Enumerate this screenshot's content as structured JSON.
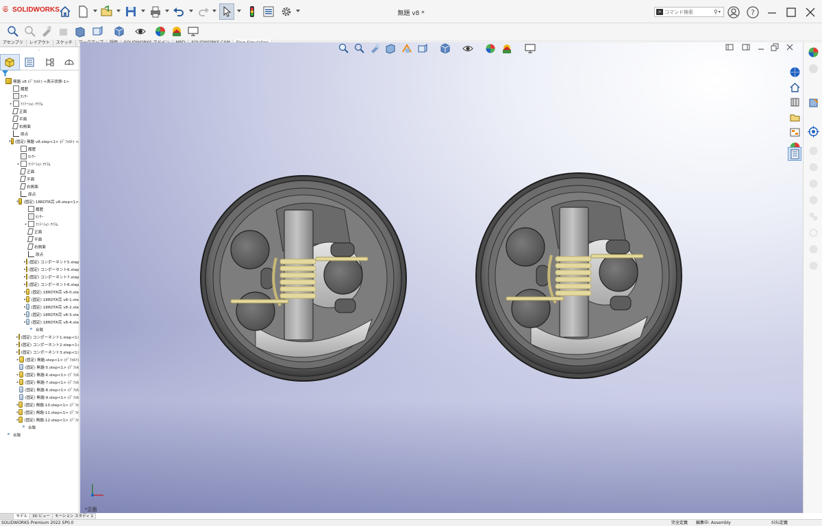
{
  "app": {
    "logo_text": "SOLIDWORKS",
    "document_title": "無題 v8 *",
    "search_placeholder": "コマンド検索"
  },
  "quick_access": [
    {
      "name": "home-icon"
    },
    {
      "name": "new-document-icon"
    },
    {
      "name": "open-icon"
    },
    {
      "name": "save-icon"
    },
    {
      "name": "print-icon"
    },
    {
      "name": "undo-icon"
    },
    {
      "name": "redo-icon"
    },
    {
      "name": "select-icon"
    },
    {
      "name": "rebuild-traffic-light-icon"
    },
    {
      "name": "file-properties-icon"
    },
    {
      "name": "options-gear-icon"
    }
  ],
  "command_tabs": [
    "アセンブリ",
    "レイアウト",
    "スケッチ",
    "マークアップ",
    "評価",
    "SOLIDWORKS アドイン",
    "MBD",
    "SOLIDWORKS CAM",
    "Flow Simulation"
  ],
  "panel_tabs": [
    "featuremanager-icon",
    "propertymanager-icon",
    "configurationmanager-icon",
    "dimxpert-icon"
  ],
  "tree": [
    {
      "indent": 0,
      "exp": "",
      "icon": "asm",
      "label": "無題 v8 (ﾃﾞﾌｫﾙﾄ) <表示状態-1>"
    },
    {
      "indent": 1,
      "exp": "",
      "icon": "hist",
      "label": "履歴"
    },
    {
      "indent": 1,
      "exp": "",
      "icon": "sens",
      "label": "ｾﾝｻｰ"
    },
    {
      "indent": 1,
      "exp": "▸",
      "icon": "ann",
      "label": "ｱﾉﾃｰｼｮﾝ ｱｲﾃﾑ"
    },
    {
      "indent": 1,
      "exp": "",
      "icon": "plane",
      "label": "正面"
    },
    {
      "indent": 1,
      "exp": "",
      "icon": "plane",
      "label": "平面"
    },
    {
      "indent": 1,
      "exp": "",
      "icon": "plane",
      "label": "右側面"
    },
    {
      "indent": 1,
      "exp": "",
      "icon": "origin",
      "label": "原点"
    },
    {
      "indent": 1,
      "exp": "▾",
      "icon": "asm",
      "label": "(固定) 無題 v8.step<1> (ﾃﾞﾌｫﾙﾄ) <"
    },
    {
      "indent": 2,
      "exp": "",
      "icon": "hist",
      "label": "履歴"
    },
    {
      "indent": 2,
      "exp": "",
      "icon": "sens",
      "label": "ｾﾝｻｰ"
    },
    {
      "indent": 2,
      "exp": "▸",
      "icon": "ann",
      "label": "ｱﾉﾃｰｼｮﾝ ｱｲﾃﾑ"
    },
    {
      "indent": 2,
      "exp": "",
      "icon": "plane",
      "label": "正面"
    },
    {
      "indent": 2,
      "exp": "",
      "icon": "plane",
      "label": "平面"
    },
    {
      "indent": 2,
      "exp": "",
      "icon": "plane",
      "label": "右側面"
    },
    {
      "indent": 2,
      "exp": "",
      "icon": "origin",
      "label": "原点"
    },
    {
      "indent": 2,
      "exp": "▾",
      "icon": "asm",
      "label": "(固定) 18RDTA完 v8.step<1>"
    },
    {
      "indent": 3,
      "exp": "",
      "icon": "hist",
      "label": "履歴"
    },
    {
      "indent": 3,
      "exp": "",
      "icon": "sens",
      "label": "ｾﾝｻｰ"
    },
    {
      "indent": 3,
      "exp": "▸",
      "icon": "ann",
      "label": "ｱﾉﾃｰｼｮﾝ ｱｲﾃﾑ"
    },
    {
      "indent": 3,
      "exp": "",
      "icon": "plane",
      "label": "正面"
    },
    {
      "indent": 3,
      "exp": "",
      "icon": "plane",
      "label": "平面"
    },
    {
      "indent": 3,
      "exp": "",
      "icon": "plane",
      "label": "右側面"
    },
    {
      "indent": 3,
      "exp": "",
      "icon": "origin",
      "label": "原点"
    },
    {
      "indent": 3,
      "exp": "▸",
      "icon": "part",
      "label": "(固定) コンポーネント5.step-"
    },
    {
      "indent": 3,
      "exp": "▸",
      "icon": "part",
      "label": "(固定) コンポーネント6.step-"
    },
    {
      "indent": 3,
      "exp": "▸",
      "icon": "part",
      "label": "(固定) コンポーネント7.step-"
    },
    {
      "indent": 3,
      "exp": "▸",
      "icon": "part",
      "label": "(固定) コンポーネント8.step-"
    },
    {
      "indent": 3,
      "exp": "▸",
      "icon": "part",
      "label": "(固定) 18RDTA完 v8-0.ste"
    },
    {
      "indent": 3,
      "exp": "▸",
      "icon": "part",
      "label": "(固定) 18RDTA完 v8-1.ste"
    },
    {
      "indent": 3,
      "exp": "▸",
      "icon": "cut",
      "label": "(固定) 18RDTA完 v8-2.ste"
    },
    {
      "indent": 3,
      "exp": "▸",
      "icon": "cut",
      "label": "(固定) 18RDTA完 v8-3.ste"
    },
    {
      "indent": 3,
      "exp": "▸",
      "icon": "cut",
      "label": "(固定) 18RDTA完 v8-4.ste"
    },
    {
      "indent": 3,
      "exp": "",
      "icon": "mate",
      "label": "合致"
    },
    {
      "indent": 2,
      "exp": "▸",
      "icon": "part",
      "label": "(固定) コンポーネント1.step<1>"
    },
    {
      "indent": 2,
      "exp": "▸",
      "icon": "part",
      "label": "(固定) コンポーネント2.step<1>"
    },
    {
      "indent": 2,
      "exp": "▸",
      "icon": "part",
      "label": "(固定) コンポーネント3.step<1>"
    },
    {
      "indent": 2,
      "exp": "▸",
      "icon": "part",
      "label": "(固定) 無題.step<1> (ﾃﾞﾌｫﾙﾄ)"
    },
    {
      "indent": 2,
      "exp": "",
      "icon": "cut",
      "label": "(固定) 無題-5.step<1> (ﾃﾞﾌｫﾙ"
    },
    {
      "indent": 2,
      "exp": "▸",
      "icon": "part",
      "label": "(固定) 無題-6.step<1> (ﾃﾞﾌｫﾙ"
    },
    {
      "indent": 2,
      "exp": "▸",
      "icon": "part",
      "label": "(固定) 無題-7.step<1> (ﾃﾞﾌｫﾙ"
    },
    {
      "indent": 2,
      "exp": "",
      "icon": "cut",
      "label": "(固定) 無題-8.step<1> (ﾃﾞﾌｫﾙ"
    },
    {
      "indent": 2,
      "exp": "",
      "icon": "cut",
      "label": "(固定) 無題-9.step<1> (ﾃﾞﾌｫﾙ"
    },
    {
      "indent": 2,
      "exp": "▸",
      "icon": "part",
      "label": "(固定) 無題-10.step<1> (ﾃﾞﾌｫ"
    },
    {
      "indent": 2,
      "exp": "▸",
      "icon": "part",
      "label": "(固定) 無題-11.step<1> (ﾃﾞﾌｫ"
    },
    {
      "indent": 2,
      "exp": "▸",
      "icon": "part",
      "label": "(固定) 無題-12.step<1> (ﾃﾞﾌｫ"
    },
    {
      "indent": 2,
      "exp": "",
      "icon": "mate",
      "label": "合致"
    },
    {
      "indent": 0,
      "exp": "",
      "icon": "mate",
      "label": "合致"
    }
  ],
  "bottom_tabs": [
    "モデル",
    "3D ビュー",
    "モーション スタディ 1"
  ],
  "viewport": {
    "view_name": "*正面"
  },
  "status": {
    "product": "SOLIDWORKS Premium 2022 SP0.0",
    "state": "完全定義",
    "editing": "編集中: Assembly",
    "units": "ｶｽﾀﾑ定義"
  },
  "colors": {
    "brand": "#d7261e",
    "body": "#6b6b6b",
    "coil": "#d8cc92",
    "selection": "#cfe0f3"
  }
}
